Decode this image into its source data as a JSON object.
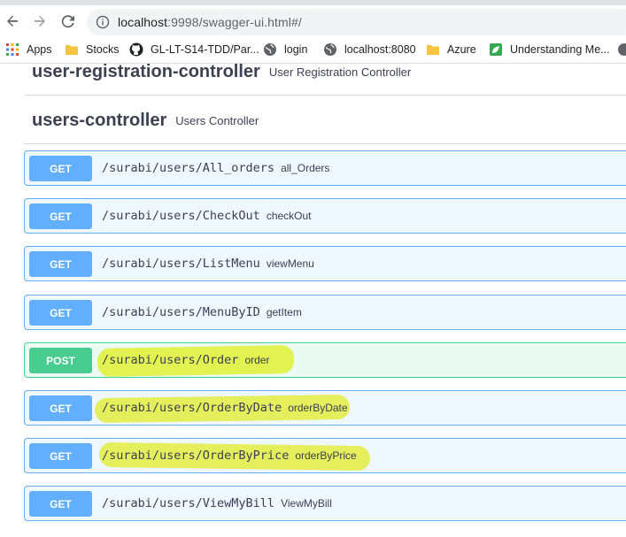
{
  "browser": {
    "url_host": "localhost",
    "url_rest": ":9998/swagger-ui.html#/",
    "bookmarks": [
      {
        "label": "Apps",
        "icon": "apps-grid-icon"
      },
      {
        "label": "Stocks",
        "icon": "folder-icon"
      },
      {
        "label": "GL-LT-S14-TDD/Par...",
        "icon": "github-icon"
      },
      {
        "label": "login",
        "icon": "globe-icon"
      },
      {
        "label": "localhost:8080",
        "icon": "globe-icon"
      },
      {
        "label": "Azure",
        "icon": "folder-icon"
      },
      {
        "label": "Understanding Me...",
        "icon": "leaf-icon"
      }
    ]
  },
  "tags": [
    {
      "name": "user-registration-controller",
      "description": "User Registration Controller"
    },
    {
      "name": "users-controller",
      "description": "Users Controller"
    }
  ],
  "operations": [
    {
      "method": "GET",
      "path": "/surabi/users/All_orders",
      "summary": "all_Orders",
      "highlighted": false
    },
    {
      "method": "GET",
      "path": "/surabi/users/CheckOut",
      "summary": "checkOut",
      "highlighted": false
    },
    {
      "method": "GET",
      "path": "/surabi/users/ListMenu",
      "summary": "viewMenu",
      "highlighted": false
    },
    {
      "method": "GET",
      "path": "/surabi/users/MenuByID",
      "summary": "getItem",
      "highlighted": false
    },
    {
      "method": "POST",
      "path": "/surabi/users/Order",
      "summary": "order",
      "highlighted": true
    },
    {
      "method": "GET",
      "path": "/surabi/users/OrderByDate",
      "summary": "orderByDate",
      "highlighted": true
    },
    {
      "method": "GET",
      "path": "/surabi/users/OrderByPrice",
      "summary": "orderByPrice",
      "highlighted": true
    },
    {
      "method": "GET",
      "path": "/surabi/users/ViewMyBill",
      "summary": "ViewMyBill",
      "highlighted": false
    }
  ],
  "colors": {
    "get": "#61affe",
    "post": "#49cc90",
    "highlight": "#f2f52a"
  }
}
